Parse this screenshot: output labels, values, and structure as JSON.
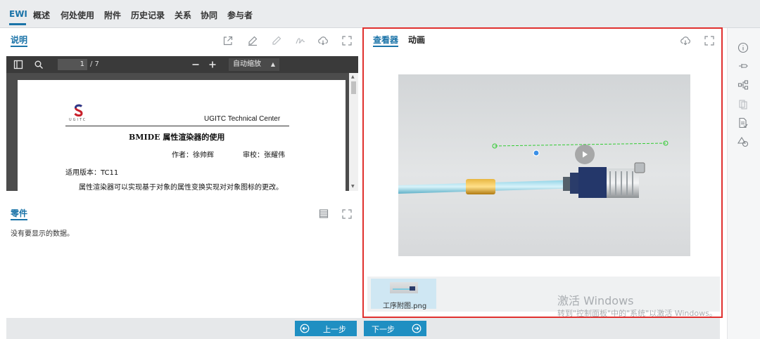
{
  "top_tabs": [
    "EWI",
    "概述",
    "何处使用",
    "附件",
    "历史记录",
    "关系",
    "协同",
    "参与者"
  ],
  "description_panel": {
    "title": "说明"
  },
  "pdf_toolbar": {
    "page_current": "1",
    "page_total": "/ 7",
    "zoom_value": "自动缩放"
  },
  "document": {
    "logo_text": "UGITC",
    "header_right": "UGITC Technical Center",
    "title": "BMIDE 属性渲染器的使用",
    "author_line": "作者：徐帅辉",
    "reviewer_line": "审校：张耀伟",
    "version_line": "适用版本：TC11",
    "body_line": "属性渲染器可以实现基于对象的属性变换实现对对象图标的更改。"
  },
  "parts_panel": {
    "title": "零件",
    "empty_text": "没有要显示的数据。"
  },
  "viewer": {
    "tab_viewer": "查看器",
    "tab_animation": "动画",
    "thumbnail_label": "工序附图.png"
  },
  "watermark": {
    "line1": "激活 Windows",
    "line2": "转到\"控制面板\"中的\"系统\"以激活 Windows。"
  },
  "buttons": {
    "prev": "上一步",
    "next": "下一步"
  },
  "colors": {
    "accent": "#1a73a8",
    "highlight_border": "#e0302e",
    "button": "#1f8fc2"
  },
  "icons": {
    "description_tools": [
      "share-icon",
      "edit-icon",
      "pencil-icon",
      "signature-icon",
      "download-icon",
      "fullscreen-icon"
    ],
    "pdf_tools": [
      "sidebar-toggle-icon",
      "search-icon",
      "zoom-out-icon",
      "zoom-in-icon"
    ],
    "sidebar": [
      "info-icon",
      "pin-icon",
      "structure-icon",
      "clipboard-icon",
      "document-report-icon",
      "shapes-icon"
    ]
  }
}
